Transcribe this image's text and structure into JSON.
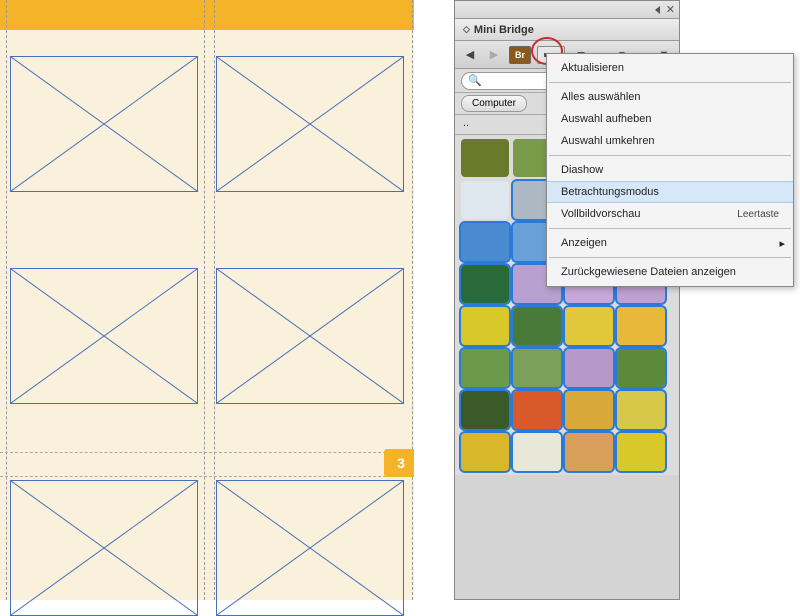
{
  "canvas": {
    "page_number": "3"
  },
  "panel": {
    "title": "Mini Bridge",
    "br_label": "Br",
    "search_placeholder": "",
    "computer_button": "Computer",
    "path_label": ".."
  },
  "menu": {
    "aktualisieren": "Aktualisieren",
    "alles_auswaehlen": "Alles auswählen",
    "auswahl_aufheben": "Auswahl aufheben",
    "auswahl_umkehren": "Auswahl umkehren",
    "diashow": "Diashow",
    "betrachtungsmodus": "Betrachtungsmodus",
    "vollbildvorschau": "Vollbildvorschau",
    "vollbild_shortcut": "Leertaste",
    "anzeigen": "Anzeigen",
    "zurueckgewiesene": "Zurückgewiesene Dateien anzeigen"
  },
  "thumbnails": {
    "selected_from_index": 5,
    "colors": [
      "#6a7a2a",
      "#7a9a4a",
      "#889a5a",
      "#7a7a3a",
      "#dfe8ef",
      "#aeb8c2",
      "#a8b8c8",
      "#a0b0c0",
      "#4a8ad0",
      "#6aa0d8",
      "#c85a9a",
      "#d86aa0",
      "#2a6a3a",
      "#b8a0d0",
      "#c8a8d8",
      "#c0a0d0",
      "#d8c82a",
      "#4a7a3a",
      "#e0c83a",
      "#e8b83a",
      "#6a9a4a",
      "#7aa05a",
      "#b898c8",
      "#5a8a3a",
      "#3a5a2a",
      "#d85a2a",
      "#d8a83a",
      "#d8c84a",
      "#d8b82a",
      "#e8e8d8",
      "#d8a05a",
      "#d8c82a"
    ]
  }
}
